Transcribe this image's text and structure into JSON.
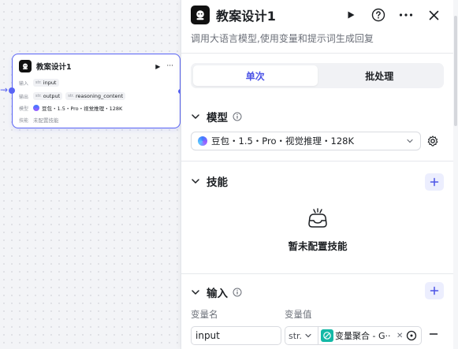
{
  "node": {
    "title": "教案设计1",
    "input_label": "输入",
    "input_type": "str.",
    "input_name": "input",
    "output_label": "输出",
    "output_type1": "str.",
    "output_name1": "output",
    "output_type2": "str.",
    "output_name2": "reasoning_content",
    "model_label": "模型",
    "model_value": "豆包・1.5・Pro・视觉推理・128K",
    "skill_label": "技能",
    "skill_value": "未配置技能"
  },
  "panel": {
    "title": "教案设计1",
    "description": "调用大语言模型,使用变量和提示词生成回复",
    "tabs": [
      {
        "label": "单次",
        "active": true
      },
      {
        "label": "批处理",
        "active": false
      }
    ],
    "model_section": {
      "title": "模型",
      "selected": "豆包・1.5・Pro・视觉推理・128K"
    },
    "skills_section": {
      "title": "技能",
      "empty_text": "暂未配置技能"
    },
    "input_section": {
      "title": "输入",
      "col_name": "变量名",
      "col_value": "变量值",
      "var_name": "input",
      "var_type": "str.",
      "var_value": "变量聚合 - G··"
    }
  },
  "colors": {
    "accent": "#4c54e6",
    "node_border": "#5964f5",
    "value_icon": "#14b8a6"
  },
  "icons": [
    "play-icon",
    "help-icon",
    "more-icon",
    "close-icon",
    "chevron-down-icon",
    "info-icon",
    "gear-icon",
    "plus-icon",
    "empty-skill-icon",
    "variable-aggregate-icon",
    "target-icon"
  ]
}
